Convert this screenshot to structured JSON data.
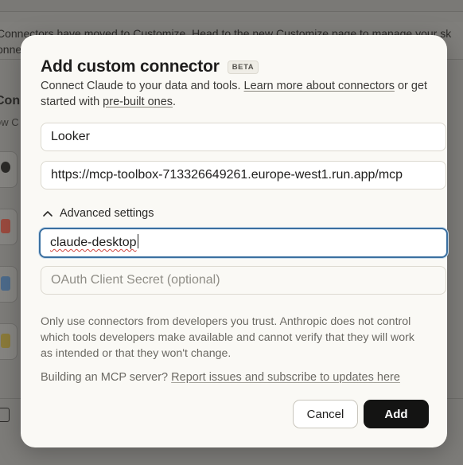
{
  "background": {
    "banner_line1": "Connectors have moved to Customize. Head to the new Customize page to manage your sk",
    "banner_line2": "onnec",
    "section_title": "Conne",
    "section_sub": "ow C"
  },
  "dialog": {
    "title": "Add custom connector",
    "badge": "BETA",
    "description_prefix": "Connect Claude to your data and tools. ",
    "learn_more_link": "Learn more about connectors",
    "description_middle": " or get started with ",
    "prebuilt_link": "pre-built ones",
    "description_suffix": ".",
    "name_field_value": "Looker",
    "url_field_value": "https://mcp-toolbox-713326649261.europe-west1.run.app/mcp",
    "advanced_settings_label": "Advanced settings",
    "client_id_value": "claude-desktop",
    "client_secret_placeholder": "OAuth Client Secret (optional)",
    "warning_text": "Only use connectors from developers you trust. Anthropic does not control which tools developers make available and cannot verify that they will work as intended or that they won't change.",
    "mcp_prefix": "Building an MCP server? ",
    "mcp_link": "Report issues and subscribe to updates here",
    "cancel_label": "Cancel",
    "add_label": "Add"
  },
  "colors": {
    "accent_focus": "#3a6fa0",
    "primary_button": "#141413",
    "dialog_background": "#faf9f5"
  },
  "icons": [
    "chevron-up-icon",
    "github-icon",
    "gmail-icon",
    "calendar-icon",
    "drive-icon",
    "keyboard-icon"
  ]
}
